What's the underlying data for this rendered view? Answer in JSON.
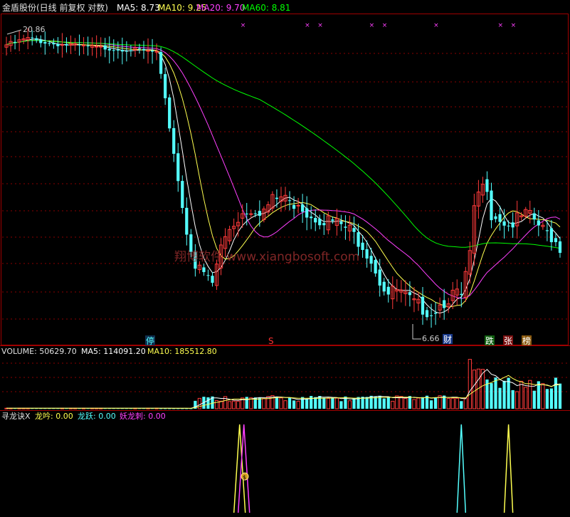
{
  "header": {
    "stock_title": "金盾股份(日线 前复权 对数)",
    "ma5_label": "MA5: 8.73",
    "ma10_label": "MA10: 9.25",
    "ma20_label": "MA20: 9.70",
    "ma60_label": "MA60: 8.81"
  },
  "volume_header": {
    "volume_label": "VOLUME: 50629.70",
    "ma5_label": "MA5: 114091.20",
    "ma10_label": "MA10: 185512.80"
  },
  "indicator_header": {
    "name": "寻龙诀X",
    "longyin_label": "龙吟: 0.00",
    "longyue_label": "龙跃: 0.00",
    "yaolongci_label": "妖龙刺: 0.00"
  },
  "annotations": {
    "high_price": "20.86",
    "low_price": "6.66",
    "watermark": "翔博软件 www.xiangbosoft.com",
    "tag_ting": "停",
    "tag_s": "S",
    "tag_cai": "财",
    "tag_die": "跌",
    "tag_zhang": "张",
    "tag_bang": "榜",
    "tag_money": "$"
  },
  "colors": {
    "up": "#ff3b3b",
    "down": "#54ffff",
    "ma5": "#ffffff",
    "ma10": "#ffff50",
    "ma20": "#ff40ff",
    "ma60": "#00ff00",
    "grid": "#8b0000",
    "longyin": "#ffff50",
    "longyue": "#54ffff",
    "yaolongci": "#ff40ff"
  },
  "chart_data": {
    "type": "candlestick",
    "scale": "log",
    "price_range": [
      6.0,
      22.0
    ],
    "price_extremes": {
      "high": 20.86,
      "low": 6.66
    },
    "series": [
      {
        "name": "MA5",
        "value": 8.73
      },
      {
        "name": "MA10",
        "value": 9.25
      },
      {
        "name": "MA20",
        "value": 9.7
      },
      {
        "name": "MA60",
        "value": 8.81
      }
    ],
    "volume": {
      "last": 50629.7,
      "ma5": 114091.2,
      "ma10": 185512.8
    },
    "indicator": {
      "name": "寻龙诀X",
      "longyin": 0.0,
      "longyue": 0.0,
      "yaolongci": 0.0
    }
  }
}
